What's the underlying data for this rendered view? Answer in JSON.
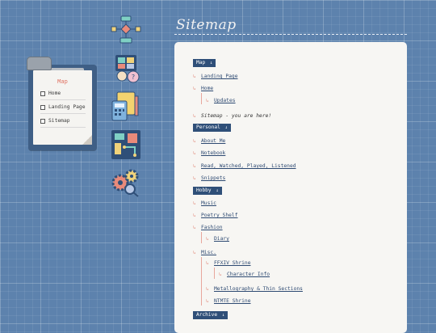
{
  "page": {
    "title": "Sitemap"
  },
  "clipboard": {
    "title": "Map",
    "items": [
      "Home",
      "Landing Page",
      "Sitemap"
    ]
  },
  "icons": [
    "flowchart-icon",
    "profile-icon",
    "calculator-icon",
    "circuit-board-icon",
    "gears-icon"
  ],
  "sitemap": {
    "sections": [
      {
        "label": "Map",
        "arrow": "↓"
      },
      {
        "label": "Personal",
        "arrow": "↓"
      },
      {
        "label": "Hobby",
        "arrow": "↓"
      },
      {
        "label": "Archive",
        "arrow": "↓"
      }
    ],
    "map": {
      "landing": "Landing Page",
      "home": "Home",
      "updates": "Updates",
      "sitemap_here": "Sitemap - you are here!"
    },
    "personal": [
      "About Me",
      "Notebook",
      "Read, Watched, Played, Listened",
      "Snippets"
    ],
    "hobby": {
      "music": "Music",
      "poetry": "Poetry Shelf",
      "fashion": "Fashion",
      "diary": "Diary",
      "misc": "Misc.",
      "ffxiv": "FFXIV Shrine",
      "character": "Character Info",
      "metallography": "Metallography & Thin Sections",
      "ntmte": "NTMTE Shrine"
    }
  }
}
